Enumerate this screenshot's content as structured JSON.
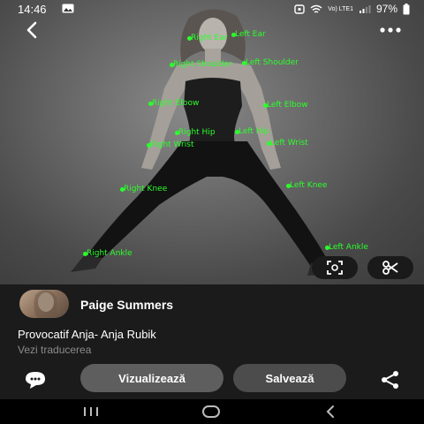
{
  "status_bar": {
    "time": "14:46",
    "network_label": "Vo) LTE1",
    "battery": "97%"
  },
  "icons": {
    "back": "back-arrow-icon",
    "more": "more-dots-icon",
    "lens": "visual-search-icon",
    "cut": "scissors-icon",
    "comment": "comment-icon",
    "share": "share-icon"
  },
  "keypoints": {
    "right_ear": "Right Ear",
    "left_ear": "Left Ear",
    "right_shoulder": "Right Shoulder",
    "left_shoulder": "Left Shoulder",
    "right_elbow": "Right Elbow",
    "left_elbow": "Left Elbow",
    "right_hip": "Right Hip",
    "left_hip": "Left Hip",
    "right_wrist": "Right Wrist",
    "left_wrist": "Left Wrist",
    "right_knee": "Right Knee",
    "left_knee": "Left Knee",
    "right_ankle": "Right Ankle",
    "left_ankle": "Left Ankle"
  },
  "pin": {
    "author": "Paige Summers",
    "title": "Provocatif Anja- Anja Rubik",
    "translate": "Vezi traducerea",
    "visit_label": "Vizualizează",
    "save_label": "Salvează"
  },
  "colors": {
    "keypoint": "#2bff2b",
    "sheet_bg": "#1b1b1b",
    "visit_bg": "#5e5e5e",
    "save_bg": "#4c4c4c"
  }
}
